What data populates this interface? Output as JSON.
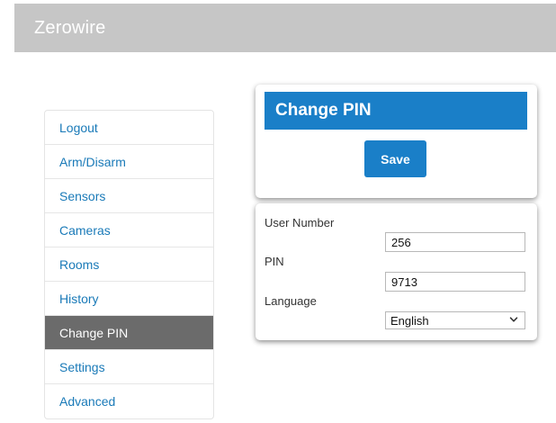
{
  "app": {
    "title": "Zerowire"
  },
  "sidebar": {
    "items": [
      {
        "label": "Logout",
        "active": false
      },
      {
        "label": "Arm/Disarm",
        "active": false
      },
      {
        "label": "Sensors",
        "active": false
      },
      {
        "label": "Cameras",
        "active": false
      },
      {
        "label": "Rooms",
        "active": false
      },
      {
        "label": "History",
        "active": false
      },
      {
        "label": "Change PIN",
        "active": true
      },
      {
        "label": "Settings",
        "active": false
      },
      {
        "label": "Advanced",
        "active": false
      }
    ]
  },
  "main": {
    "header_title": "Change PIN",
    "save_label": "Save",
    "form": {
      "user_number_label": "User Number",
      "user_number_value": "256",
      "pin_label": "PIN",
      "pin_value": "9713",
      "language_label": "Language",
      "language_value": "English"
    }
  },
  "colors": {
    "topbar": "#c6c6c6",
    "accent": "#1a7fc8",
    "link": "#1a7ab8",
    "active_nav": "#6b6b6b"
  },
  "icons": {
    "select_arrow": "chevron-down-icon"
  }
}
